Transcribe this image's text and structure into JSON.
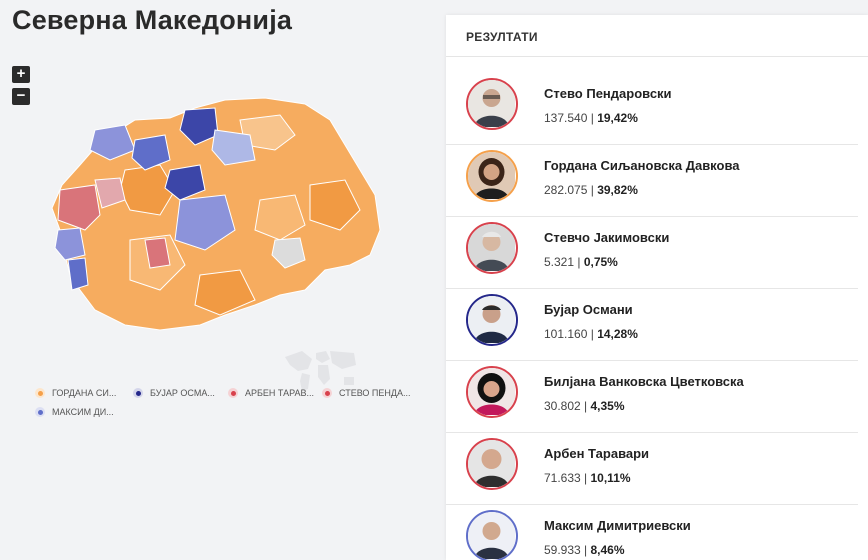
{
  "page": {
    "title": "Северна Македонија"
  },
  "zoom": {
    "in_label": "+",
    "out_label": "−"
  },
  "colors": {
    "pendarovski": "#d8414c",
    "davkova": "#f5a04a",
    "jakimovski": "#d8414c",
    "osmani": "#24278a",
    "vankovska": "#c2185b",
    "taravari": "#d8414c",
    "dimitrievski": "#5f6ec9",
    "map_no_data": "#dcdcdc"
  },
  "legend": [
    {
      "label": "ГОРДАНА СИ...",
      "color": "#f5a04a"
    },
    {
      "label": "БУЈАР ОСМА...",
      "color": "#24278a"
    },
    {
      "label": "АРБЕН ТАРАВ...",
      "color": "#d8414c"
    },
    {
      "label": "СТЕВО ПЕНДА...",
      "color": "#d8414c"
    },
    {
      "label": "МАКСИМ ДИ...",
      "color": "#5f6ec9"
    }
  ],
  "results": {
    "heading": "РЕЗУЛТАТИ",
    "candidates": [
      {
        "name": "Стево Пендаровски",
        "votes": "137.540",
        "sep": " | ",
        "pct": "19,42%",
        "ring": "#d8414c",
        "icon": "person-avatar-icon"
      },
      {
        "name": "Гордана Сиљановска Давкова",
        "votes": "282.075",
        "sep": " | ",
        "pct": "39,82%",
        "ring": "#f5a04a",
        "icon": "person-avatar-icon"
      },
      {
        "name": "Стевчо Јакимовски",
        "votes": "5.321",
        "sep": " | ",
        "pct": "0,75%",
        "ring": "#d8414c",
        "icon": "person-avatar-icon"
      },
      {
        "name": "Бујар Османи",
        "votes": "101.160",
        "sep": " | ",
        "pct": "14,28%",
        "ring": "#24278a",
        "icon": "person-avatar-icon"
      },
      {
        "name": "Билјана Ванковска Цветковска",
        "votes": "30.802",
        "sep": " | ",
        "pct": "4,35%",
        "ring": "#d8414c",
        "icon": "person-avatar-icon"
      },
      {
        "name": "Арбен Таравари",
        "votes": "71.633",
        "sep": " | ",
        "pct": "10,11%",
        "ring": "#d8414c",
        "icon": "person-avatar-icon"
      },
      {
        "name": "Максим Димитриевски",
        "votes": "59.933",
        "sep": " | ",
        "pct": "8,46%",
        "ring": "#5f6ec9",
        "icon": "person-avatar-icon"
      }
    ]
  }
}
